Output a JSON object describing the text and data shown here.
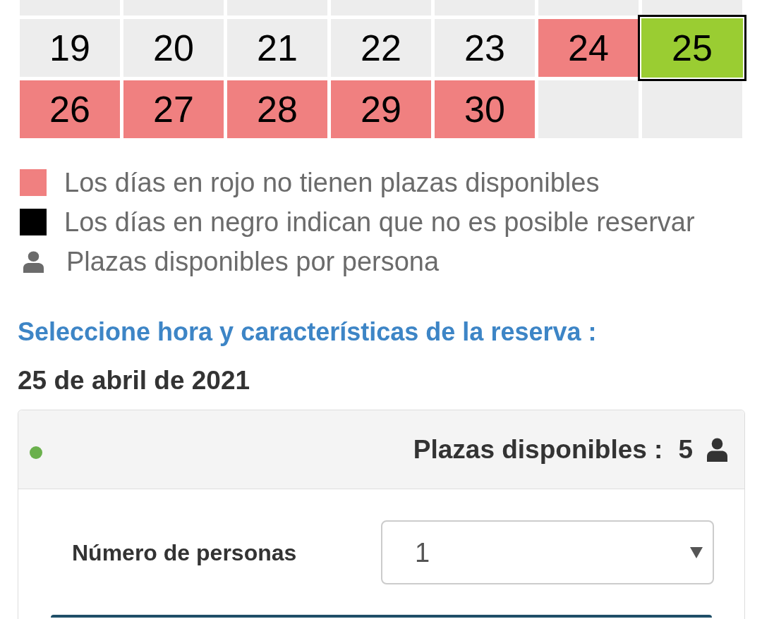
{
  "calendar": {
    "partial_week": [
      {
        "full": false
      },
      {
        "full": false
      },
      {
        "full": false
      },
      {
        "full": false
      },
      {
        "full": false
      },
      {
        "full": false
      },
      {
        "full": false
      }
    ],
    "weeks": [
      [
        {
          "kind": "day",
          "day": "19",
          "full": false,
          "selected": false
        },
        {
          "kind": "day",
          "day": "20",
          "full": false,
          "selected": false
        },
        {
          "kind": "day",
          "day": "21",
          "full": false,
          "selected": false
        },
        {
          "kind": "day",
          "day": "22",
          "full": false,
          "selected": false
        },
        {
          "kind": "day",
          "day": "23",
          "full": false,
          "selected": false
        },
        {
          "kind": "day",
          "day": "24",
          "full": true,
          "selected": false
        },
        {
          "kind": "day",
          "day": "25",
          "full": false,
          "selected": true
        }
      ],
      [
        {
          "kind": "day",
          "day": "26",
          "full": true,
          "selected": false
        },
        {
          "kind": "day",
          "day": "27",
          "full": true,
          "selected": false
        },
        {
          "kind": "day",
          "day": "28",
          "full": true,
          "selected": false
        },
        {
          "kind": "day",
          "day": "29",
          "full": true,
          "selected": false
        },
        {
          "kind": "day",
          "day": "30",
          "full": true,
          "selected": false
        },
        {
          "kind": "blank"
        },
        {
          "kind": "blank"
        }
      ]
    ]
  },
  "legend": [
    {
      "kind": "swatch",
      "color": "#f08080",
      "text": "Los días en rojo no tienen plazas disponibles"
    },
    {
      "kind": "swatch",
      "color": "#000000",
      "text": "Los días en negro indican que no es posible reservar"
    },
    {
      "kind": "person",
      "text": "Plazas disponibles por persona"
    }
  ],
  "section": {
    "heading": "Seleccione hora y características de la reserva :",
    "date": "25 de abril de 2021"
  },
  "slot": {
    "available": true,
    "seats_label": "Plazas disponibles :",
    "seats": "5",
    "people_label": "Número de personas",
    "people_value": "1"
  }
}
